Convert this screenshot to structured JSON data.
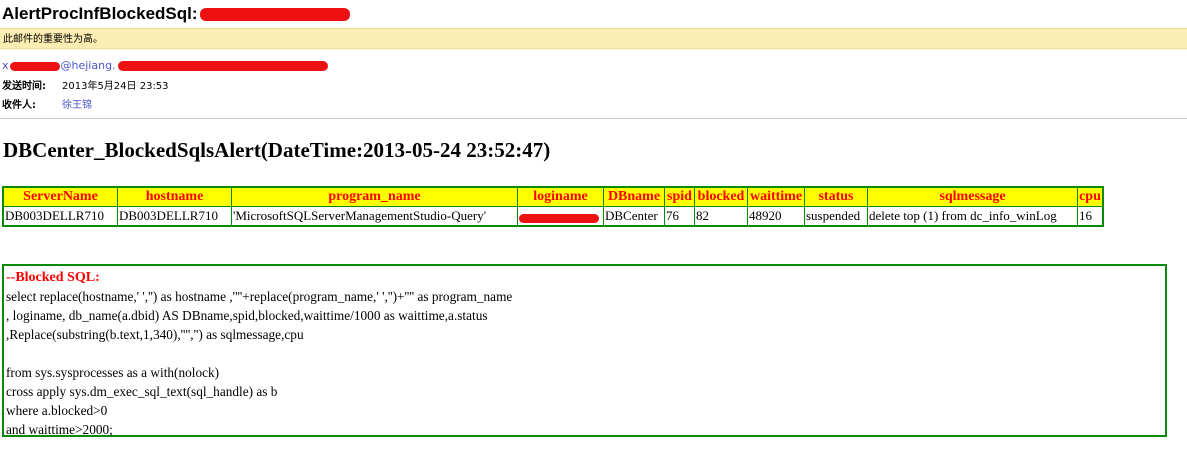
{
  "email": {
    "subject": "AlertProcInfBlockedSql:",
    "importance_notice": "此邮件的重要性为高。",
    "from_visible": "x",
    "from_domain_fragment": "@hejiang.",
    "sent_label": "发送时间:",
    "sent_value": "2013年5月24日  23:53",
    "to_label": "收件人:",
    "to_value": "徐王锦"
  },
  "report": {
    "title": "DBCenter_BlockedSqlsAlert(DateTime:2013-05-24 23:52:47)",
    "columns": [
      "ServerName",
      "hostname",
      "program_name",
      "loginame",
      "DBname",
      "spid",
      "blocked",
      "waittime",
      "status",
      "sqlmessage",
      "cpu"
    ],
    "rows": [
      [
        "DB003DELLR710",
        "DB003DELLR710",
        "'MicrosoftSQLServerManagementStudio-Query'",
        "",
        "DBCenter",
        "76",
        "82",
        "48920",
        "suspended",
        "delete top (1) from dc_info_winLog",
        "16"
      ]
    ]
  },
  "sql": {
    "heading": "--Blocked SQL:",
    "lines": [
      "select replace(hostname,' ','') as hostname ,''''+replace(program_name,' ','')+'''' as program_name",
      ", loginame, db_name(a.dbid) AS DBname,spid,blocked,waittime/1000 as waittime,a.status",
      ",Replace(substring(b.text,1,340),'''','') as sqlmessage,cpu",
      "",
      "from sys.sysprocesses as a with(nolock)",
      "cross apply sys.dm_exec_sql_text(sql_handle) as b",
      "where a.blocked>0",
      "and waittime>2000;"
    ]
  },
  "colors": {
    "header_bg": "#ffff00",
    "header_text": "#ff0000",
    "border": "#0a8a0a",
    "redaction": "#ee1111",
    "importance_bar": "#fcedb2"
  }
}
